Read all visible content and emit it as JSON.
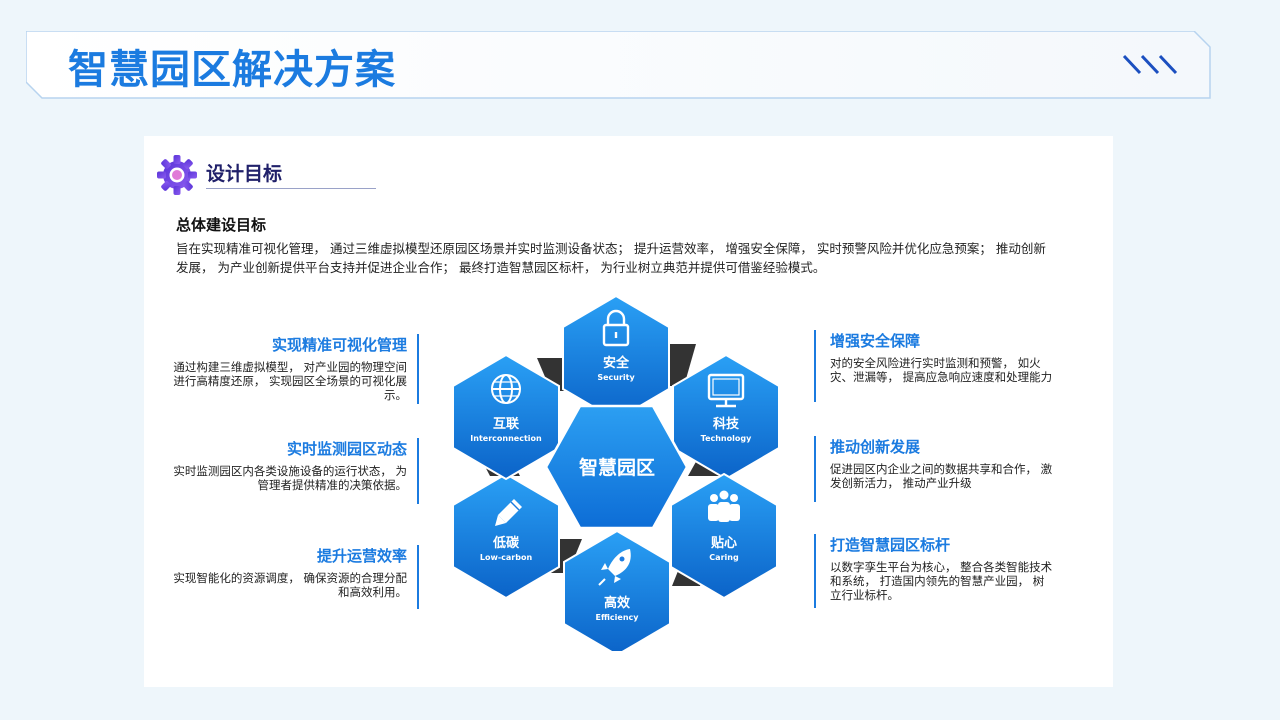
{
  "page": {
    "title": "智慧园区解决方案"
  },
  "section": {
    "title": "设计目标"
  },
  "overall": {
    "heading": "总体建设目标",
    "body": "旨在实现精准可视化管理， 通过三维虚拟模型还原园区场景并实时监测设备状态； 提升运营效率， 增强安全保障， 实时预警风险并优化应急预案； 推动创新发展， 为产业创新提供平台支持并促进企业合作； 最终打造智慧园区标杆， 为行业树立典范并提供可借鉴经验模式。"
  },
  "left_items": [
    {
      "title": "实现精准可视化管理",
      "desc": "通过构建三维虚拟模型， 对产业园的物理空间进行高精度还原， 实现园区全场景的可视化展示。"
    },
    {
      "title": "实时监测园区动态",
      "desc": "实时监测园区内各类设施设备的运行状态， 为管理者提供精准的决策依据。"
    },
    {
      "title": "提升运营效率",
      "desc": "实现智能化的资源调度， 确保资源的合理分配和高效利用。"
    }
  ],
  "right_items": [
    {
      "title": "增强安全保障",
      "desc": "对的安全风险进行实时监测和预警， 如火灾、泄漏等， 提高应急响应速度和处理能力"
    },
    {
      "title": "推动创新发展",
      "desc": "促进园区内企业之间的数据共享和合作， 激发创新活力， 推动产业升级"
    },
    {
      "title": "打造智慧园区标杆",
      "desc": "以数字孪生平台为核心， 整合各类智能技术和系统， 打造国内领先的智慧产业园， 树立行业标杆。"
    }
  ],
  "hexagons": {
    "center": "智慧园区",
    "items": [
      {
        "zh": "安全",
        "en": "Security",
        "icon": "lock-icon"
      },
      {
        "zh": "科技",
        "en": "Technology",
        "icon": "monitor-icon"
      },
      {
        "zh": "贴心",
        "en": "Caring",
        "icon": "people-icon"
      },
      {
        "zh": "高效",
        "en": "Efficiency",
        "icon": "rocket-icon"
      },
      {
        "zh": "低碳",
        "en": "Low-carbon",
        "icon": "leaf-pencil-icon"
      },
      {
        "zh": "互联",
        "en": "Interconnection",
        "icon": "network-icon"
      }
    ]
  },
  "colors": {
    "accent": "#1b7be0",
    "hex_light": "#2aa0f5",
    "hex_dark": "#0b63c8",
    "connector": "#333333"
  }
}
